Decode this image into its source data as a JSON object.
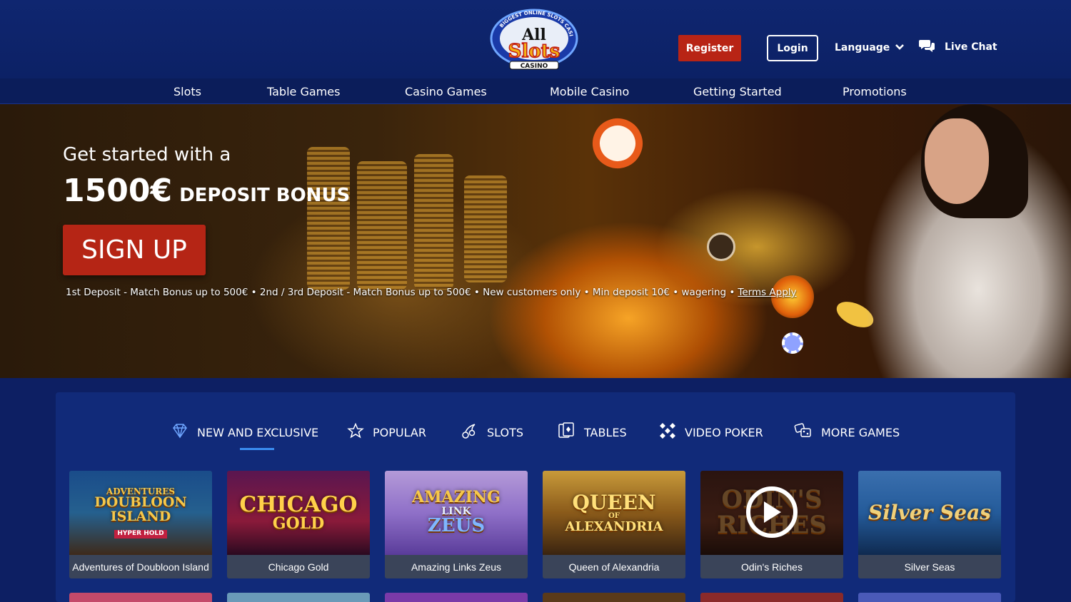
{
  "header": {
    "logo": {
      "line1": "All",
      "line2": "Slots",
      "line3": "CASINO",
      "ring_text": "BIGGEST ONLINE SLOTS CASINO"
    },
    "register_label": "Register",
    "login_label": "Login",
    "language_label": "Language",
    "livechat_label": "Live Chat"
  },
  "nav": {
    "items": [
      {
        "label": "Slots"
      },
      {
        "label": "Table Games"
      },
      {
        "label": "Casino Games"
      },
      {
        "label": "Mobile Casino"
      },
      {
        "label": "Getting Started"
      },
      {
        "label": "Promotions"
      }
    ]
  },
  "hero": {
    "line1": "Get started with a",
    "amount": "1500€",
    "bonus": "DEPOSIT BONUS",
    "signup_label": "SIGN UP",
    "terms": "1st Deposit - Match Bonus up to 500€ • 2nd / 3rd Deposit - Match Bonus up to 500€ • New customers only • Min deposit 10€ • wagering •",
    "terms_link": "Terms Apply"
  },
  "games": {
    "categories": [
      {
        "label": "NEW AND EXCLUSIVE",
        "icon": "diamond-icon",
        "active": true
      },
      {
        "label": "POPULAR",
        "icon": "star-icon",
        "active": false
      },
      {
        "label": "SLOTS",
        "icon": "cherry-icon",
        "active": false
      },
      {
        "label": "TABLES",
        "icon": "cards-icon",
        "active": false
      },
      {
        "label": "VIDEO POKER",
        "icon": "dice-icon",
        "active": false
      },
      {
        "label": "MORE GAMES",
        "icon": "tokens-icon",
        "active": false
      }
    ],
    "tiles": [
      {
        "name": "Adventures of Doubloon Island",
        "art_lines": [
          "ADVENTURES",
          "DOUBLOON",
          "ISLAND"
        ],
        "badge": "HYPER HOLD"
      },
      {
        "name": "Chicago Gold",
        "art_lines": [
          "CHICAGO",
          "GOLD"
        ]
      },
      {
        "name": "Amazing Links Zeus",
        "art_lines": [
          "AMAZING",
          "LINK",
          "ZEUS"
        ]
      },
      {
        "name": "Queen of Alexandria",
        "art_lines": [
          "QUEEN",
          "OF",
          "ALEXANDRIA"
        ]
      },
      {
        "name": "Odin's Riches",
        "art_lines": [
          "ODIN'S",
          "RICHES"
        ]
      },
      {
        "name": "Silver Seas",
        "art_lines": [
          "Silver Seas"
        ]
      }
    ]
  },
  "colors": {
    "page_bg": "#0d1f63",
    "register_bg": "#b82415",
    "signup_bg": "#b52515",
    "active_underline": "#3a8df0",
    "panel_bg": "#112a79"
  }
}
